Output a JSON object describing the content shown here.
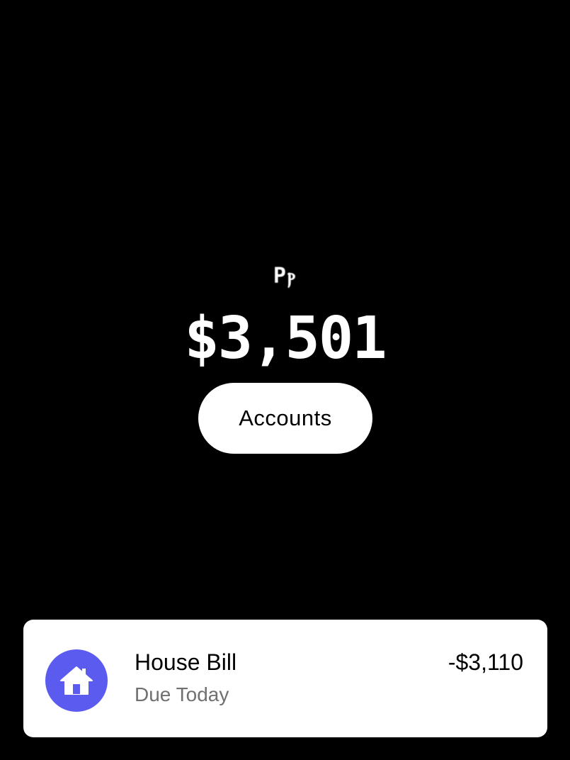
{
  "balance": {
    "label": "Pⲣ",
    "amount": "$3,501"
  },
  "accounts_button": {
    "label": "Accounts"
  },
  "bill": {
    "icon": "house-icon",
    "title": "House Bill",
    "subtitle": "Due Today",
    "amount": "-$3,110"
  },
  "colors": {
    "background": "#000000",
    "card": "#ffffff",
    "icon_bg": "#5b5bef",
    "muted_text": "#707070"
  }
}
